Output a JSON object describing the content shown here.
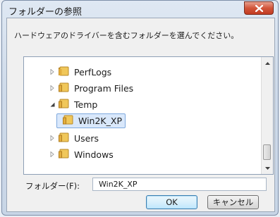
{
  "window": {
    "title": "フォルダーの参照"
  },
  "dialog": {
    "description": "ハードウェアのドライバーを含むフォルダーを選んでください。",
    "folder_label": "フォルダー(F):",
    "folder_value": "Win2K_XP",
    "ok_label": "OK",
    "cancel_label": "キャンセル"
  },
  "tree": {
    "items": [
      {
        "label": "PerfLogs",
        "expander": "collapsed",
        "selected": false
      },
      {
        "label": "Program Files",
        "expander": "collapsed",
        "selected": false
      },
      {
        "label": "Temp",
        "expander": "expanded",
        "selected": false
      },
      {
        "label": "Win2K_XP",
        "expander": "none",
        "selected": true
      },
      {
        "label": "Users",
        "expander": "collapsed",
        "selected": false
      },
      {
        "label": "Windows",
        "expander": "collapsed",
        "selected": false
      }
    ]
  },
  "icons": {
    "folder": "folder-icon",
    "close": "close-icon",
    "expand": "chevron-right-icon",
    "collapse": "triangle-down-icon"
  },
  "colors": {
    "close_button": "#c8442b",
    "selection": "#d9e8fb",
    "folder": "#e6b84a"
  }
}
